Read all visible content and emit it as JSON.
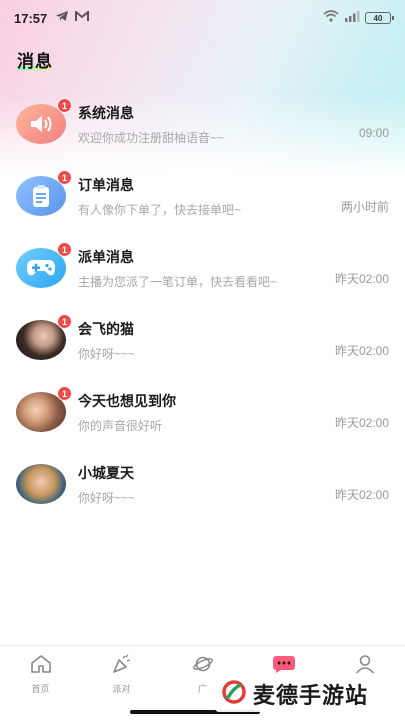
{
  "status_bar": {
    "time": "17:57",
    "battery": "40",
    "icons": [
      "telegram-icon",
      "gmail-icon",
      "wifi-icon",
      "signal-icon",
      "battery-icon"
    ]
  },
  "page": {
    "title": "消息"
  },
  "messages": [
    {
      "name": "系统消息",
      "preview": "欢迎你成功注册甜柚语音~~",
      "time": "09:00",
      "badge": "1",
      "avatar_icon": "speaker-icon",
      "avatar_color": "#f7988f"
    },
    {
      "name": "订单消息",
      "preview": "有人像你下单了，快去接单吧~",
      "time": "两小时前",
      "badge": "1",
      "avatar_icon": "clipboard-icon",
      "avatar_color": "#6fa8f0"
    },
    {
      "name": "派单消息",
      "preview": "主播为您派了一笔订单，快去看看吧~",
      "time": "昨天02:00",
      "badge": "1",
      "avatar_icon": "gamepad-icon",
      "avatar_color": "#3fb4f5"
    },
    {
      "name": "会飞的猫",
      "preview": "你好呀~~~",
      "time": "昨天02:00",
      "badge": "1",
      "avatar_icon": "user-photo",
      "avatar_color": "#6b5a52"
    },
    {
      "name": "今天也想见到你",
      "preview": "你的声音很好听",
      "time": "昨天02:00",
      "badge": "1",
      "avatar_icon": "user-photo",
      "avatar_color": "#b87a58"
    },
    {
      "name": "小城夏天",
      "preview": "你好呀~~~",
      "time": "昨天02:00",
      "badge": "",
      "avatar_icon": "user-photo",
      "avatar_color": "#4a6b85"
    }
  ],
  "tabbar": {
    "items": [
      {
        "label": "首页",
        "icon": "home-icon"
      },
      {
        "label": "派对",
        "icon": "party-icon"
      },
      {
        "label": "广",
        "icon": "planet-icon"
      },
      {
        "label": "",
        "icon": "message-icon"
      },
      {
        "label": "",
        "icon": "profile-icon"
      }
    ]
  },
  "watermark": {
    "text": "麦德手游站"
  },
  "colors": {
    "badge": "#ee4b4b",
    "active_tab": "#ff5a7a"
  }
}
